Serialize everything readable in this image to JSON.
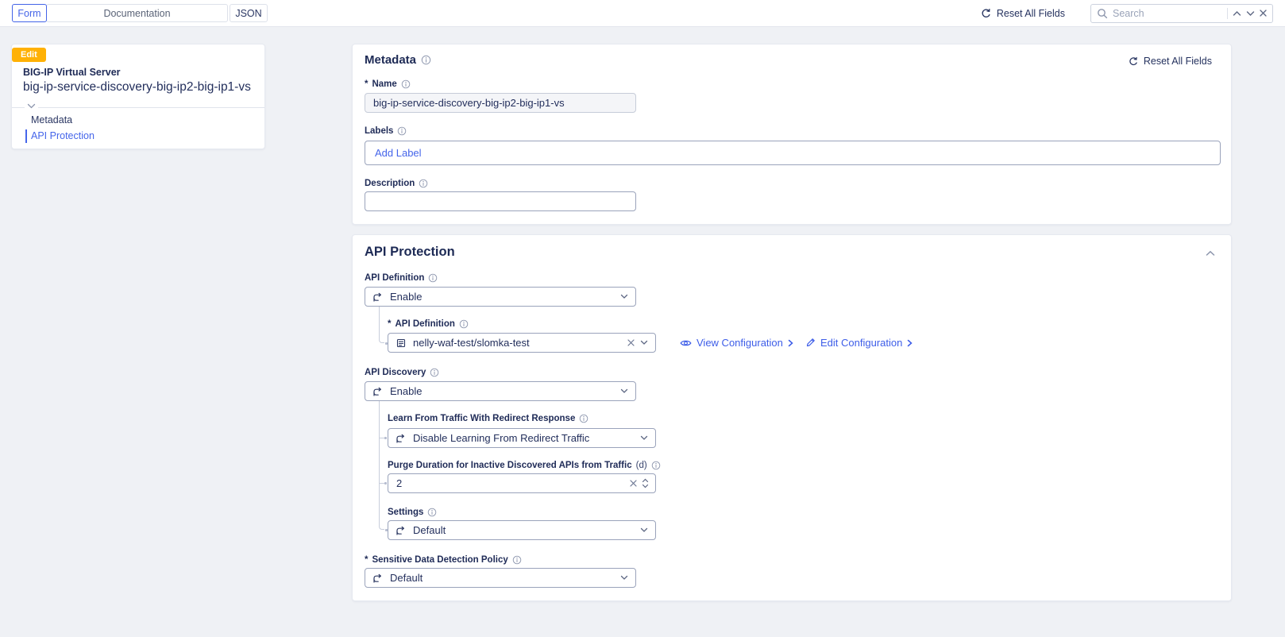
{
  "ui": {
    "required_mark": "*"
  },
  "colors": {
    "accent": "#4464e8",
    "badge": "#ffb105",
    "navy": "#1e2a56",
    "background": "#eff1f5"
  },
  "topbar": {
    "tabs": [
      {
        "label": "Form",
        "active": true
      },
      {
        "label": "Documentation",
        "active": false
      },
      {
        "label": "JSON",
        "active": false
      }
    ],
    "reset_label": "Reset All Fields",
    "search": {
      "placeholder": "Search"
    }
  },
  "sidebar": {
    "badge": "Edit",
    "type_label": "BIG-IP Virtual Server",
    "object_name": "big-ip-service-discovery-big-ip2-big-ip1-vs",
    "nav": [
      {
        "label": "Metadata",
        "active": false
      },
      {
        "label": "API Protection",
        "active": true
      }
    ]
  },
  "metadata": {
    "title": "Metadata",
    "reset_label": "Reset All Fields",
    "name": {
      "label": "Name",
      "value": "big-ip-service-discovery-big-ip2-big-ip1-vs"
    },
    "labels": {
      "label": "Labels",
      "add_label": "Add Label"
    },
    "description": {
      "label": "Description",
      "value": ""
    }
  },
  "api_protection": {
    "title": "API Protection",
    "api_definition": {
      "label": "API Definition",
      "mode": "Enable"
    },
    "api_definition_ref": {
      "label": "API Definition",
      "value": "nelly-waf-test/slomka-test",
      "view_link": "View Configuration",
      "edit_link": "Edit Configuration"
    },
    "api_discovery": {
      "label": "API Discovery",
      "mode": "Enable"
    },
    "learn_redirect": {
      "label": "Learn From Traffic With Redirect Response",
      "value": "Disable Learning From Redirect Traffic"
    },
    "purge_duration": {
      "label": "Purge Duration for Inactive Discovered APIs from Traffic",
      "unit": "(d)",
      "value": "2"
    },
    "settings": {
      "label": "Settings",
      "value": "Default"
    },
    "sensitive_data": {
      "label": "Sensitive Data Detection Policy",
      "value": "Default"
    }
  }
}
